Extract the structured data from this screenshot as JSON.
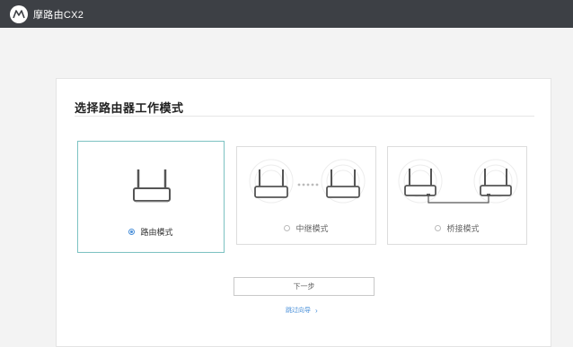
{
  "topbar": {
    "title": "摩路由CX2",
    "logo_icon": "motorola-logo-icon",
    "background": "#3d4045"
  },
  "panel": {
    "title": "选择路由器工作模式"
  },
  "modes": [
    {
      "label": "路由模式",
      "selected": true,
      "icon": "router-icon"
    },
    {
      "label": "中继模式",
      "selected": false,
      "icon": "repeater-icon"
    },
    {
      "label": "桥接模式",
      "selected": false,
      "icon": "bridge-icon"
    }
  ],
  "actions": {
    "next_label": "下一步",
    "skip_label": "跳过向导",
    "skip_icon": "chevron-right-icon"
  },
  "colors": {
    "selected_border": "#7cc2c2",
    "accent": "#4a90d9"
  }
}
